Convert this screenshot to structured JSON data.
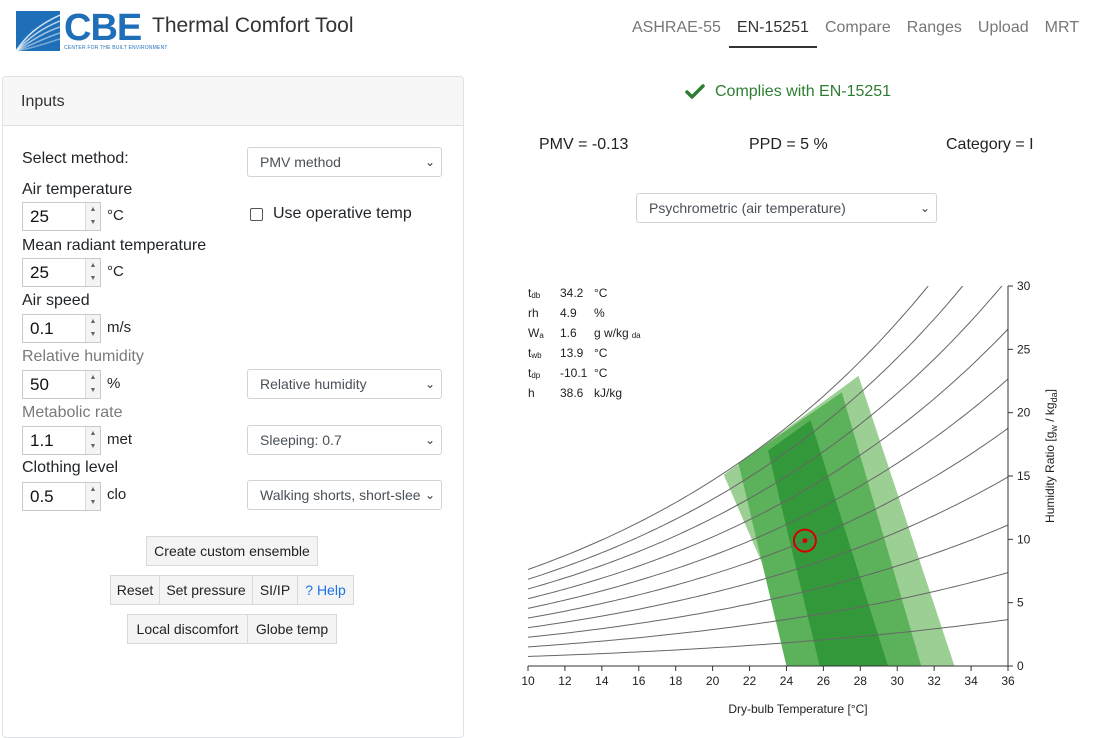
{
  "header": {
    "logo_text": "CBE",
    "logo_subtitle": "CENTER FOR THE BUILT ENVIRONMENT",
    "app_title": "Thermal Comfort Tool",
    "tabs": [
      "ASHRAE-55",
      "EN-15251",
      "Compare",
      "Ranges",
      "Upload",
      "MRT"
    ],
    "active_tab": "EN-15251"
  },
  "inputs": {
    "title": "Inputs",
    "select_method_label": "Select method:",
    "method_value": "PMV method",
    "air_temp": {
      "label": "Air temperature",
      "value": "25",
      "unit": "°C"
    },
    "use_operative_label": "Use operative temp",
    "mrt": {
      "label": "Mean radiant temperature",
      "value": "25",
      "unit": "°C"
    },
    "air_speed": {
      "label": "Air speed",
      "value": "0.1",
      "unit": "m/s"
    },
    "humidity": {
      "label": "Relative humidity",
      "value": "50",
      "unit": "%",
      "select": "Relative humidity"
    },
    "met": {
      "label": "Metabolic rate",
      "value": "1.1",
      "unit": "met",
      "select": "Sleeping: 0.7"
    },
    "clo": {
      "label": "Clothing level",
      "value": "0.5",
      "unit": "clo",
      "select": "Walking shorts, short-slee"
    },
    "buttons": {
      "custom_ensemble": "Create custom ensemble",
      "reset": "Reset",
      "set_pressure": "Set pressure",
      "si_ip": "SI/IP",
      "help": "? Help",
      "local_discomfort": "Local discomfort",
      "globe_temp": "Globe temp"
    }
  },
  "results": {
    "compliance": "Complies with EN-15251",
    "pmv": "PMV = -0.13",
    "ppd": "PPD = 5 %",
    "category": "Category = I",
    "chart_select": "Psychrometric (air temperature)"
  },
  "readout": [
    {
      "sym": "t",
      "sub": "db",
      "val": "34.2",
      "unit": "°C",
      "unit_sub": ""
    },
    {
      "sym": "rh",
      "sub": "",
      "val": "4.9",
      "unit": "%",
      "unit_sub": ""
    },
    {
      "sym": "W",
      "sub": "a",
      "val": "1.6",
      "unit": "g w/kg",
      "unit_sub": "da"
    },
    {
      "sym": "t",
      "sub": "wb",
      "val": "13.9",
      "unit": "°C",
      "unit_sub": ""
    },
    {
      "sym": "t",
      "sub": "dp",
      "val": "-10.1",
      "unit": "°C",
      "unit_sub": ""
    },
    {
      "sym": "h",
      "sub": "",
      "val": "38.6",
      "unit": "kJ/kg",
      "unit_sub": ""
    }
  ],
  "chart_data": {
    "type": "scatter",
    "xlabel": "Dry-bulb Temperature [°C]",
    "ylabel": "Humidity Ratio [g_w / kg_da]",
    "xlim": [
      10,
      36
    ],
    "ylim": [
      0,
      30
    ],
    "x_ticks": [
      10,
      12,
      14,
      16,
      18,
      20,
      22,
      24,
      26,
      28,
      30,
      32,
      34,
      36
    ],
    "y_ticks": [
      0,
      5,
      10,
      15,
      20,
      25,
      30
    ],
    "rh_curves": [
      10,
      20,
      30,
      40,
      50,
      60,
      70,
      80,
      90,
      100
    ],
    "comfort_bands": [
      {
        "category": "III",
        "color": "#9ccf94",
        "polygon": [
          [
            20.6,
            15.1
          ],
          [
            27.9,
            22.9
          ],
          [
            33.1,
            0
          ],
          [
            25.1,
            0
          ]
        ]
      },
      {
        "category": "II",
        "color": "#5cb25a",
        "polygon": [
          [
            21.4,
            16.0
          ],
          [
            27.0,
            21.6
          ],
          [
            31.3,
            0
          ],
          [
            24.0,
            0
          ]
        ]
      },
      {
        "category": "I",
        "color": "#33983a",
        "polygon": [
          [
            23.0,
            17.0
          ],
          [
            25.3,
            19.4
          ],
          [
            29.5,
            0
          ],
          [
            25.8,
            0
          ]
        ]
      }
    ],
    "point": {
      "x": 25,
      "y": 9.9,
      "color": "#d40000"
    }
  }
}
